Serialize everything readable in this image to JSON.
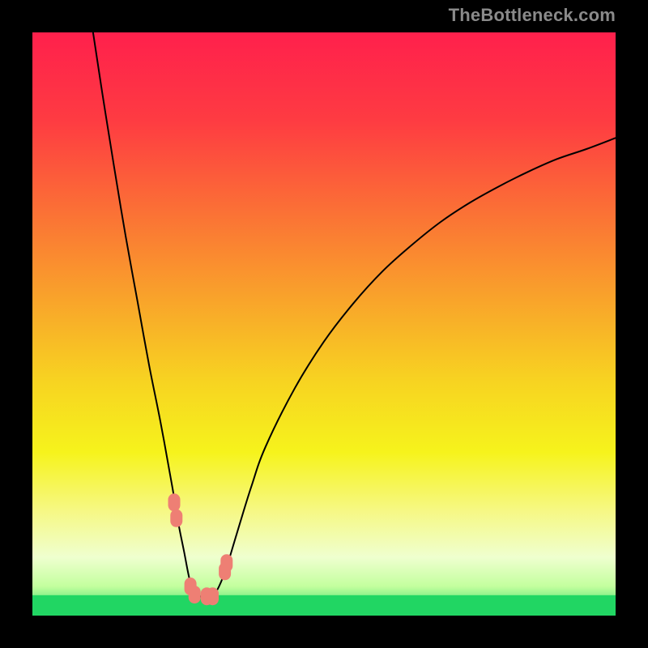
{
  "watermark": {
    "text": "TheBottleneck.com"
  },
  "chart_data": {
    "type": "line",
    "title": "",
    "xlabel": "",
    "ylabel": "",
    "xlim": [
      0,
      100
    ],
    "ylim": [
      0,
      100
    ],
    "series": [
      {
        "name": "left-curve",
        "x": [
          10.4,
          12,
          14,
          16,
          18,
          20,
          22,
          24,
          25,
          26,
          27,
          28,
          29,
          30
        ],
        "y": [
          100,
          89.5,
          77,
          65,
          54,
          43,
          33,
          22,
          16,
          11,
          6,
          3.3,
          3.3,
          3.3
        ]
      },
      {
        "name": "right-curve",
        "x": [
          30,
          31,
          32,
          33.3,
          35,
          37.5,
          40,
          45,
          50,
          55,
          60,
          65,
          70,
          75,
          80,
          85,
          90,
          95,
          100
        ],
        "y": [
          3.3,
          3.5,
          5,
          8.3,
          13.9,
          22,
          29,
          39,
          47,
          53.5,
          59,
          63.5,
          67.5,
          70.8,
          73.6,
          76.1,
          78.3,
          80,
          81.9
        ]
      }
    ],
    "markers": {
      "name": "highlighted-points",
      "color": "#ee7f74",
      "points": [
        {
          "x": 24.3,
          "y": 19.4
        },
        {
          "x": 24.7,
          "y": 16.7
        },
        {
          "x": 27.1,
          "y": 5.0
        },
        {
          "x": 27.8,
          "y": 3.6
        },
        {
          "x": 29.9,
          "y": 3.3
        },
        {
          "x": 30.9,
          "y": 3.3
        },
        {
          "x": 33.0,
          "y": 7.6
        },
        {
          "x": 33.3,
          "y": 9.0
        }
      ]
    },
    "gradient": {
      "stops": [
        {
          "offset": 0.0,
          "color": "#ff204c"
        },
        {
          "offset": 0.15,
          "color": "#fe3b42"
        },
        {
          "offset": 0.3,
          "color": "#fb6e36"
        },
        {
          "offset": 0.45,
          "color": "#f9a12b"
        },
        {
          "offset": 0.6,
          "color": "#f7d421"
        },
        {
          "offset": 0.72,
          "color": "#f6f31c"
        },
        {
          "offset": 0.82,
          "color": "#f6f884"
        },
        {
          "offset": 0.9,
          "color": "#efffcf"
        },
        {
          "offset": 0.95,
          "color": "#c3ff9e"
        },
        {
          "offset": 1.0,
          "color": "#21d663"
        }
      ]
    },
    "green_band": {
      "y0": 0,
      "y1": 3.5,
      "color": "#21d663"
    }
  }
}
